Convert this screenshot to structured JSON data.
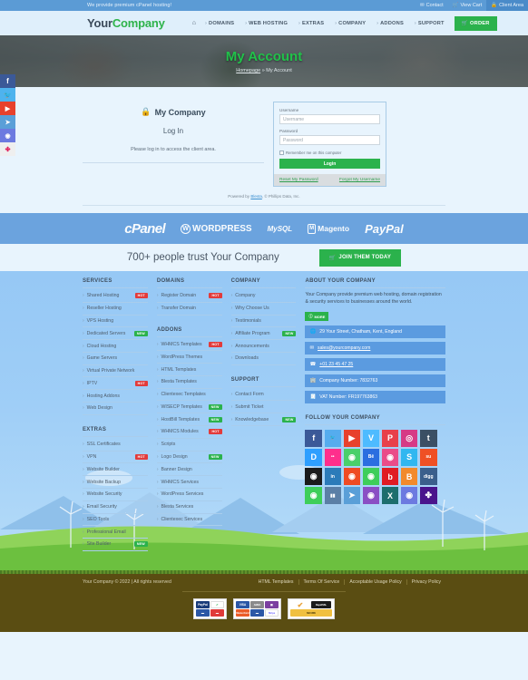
{
  "topbar": {
    "promo": "We provide premium cPanel hosting!",
    "links": [
      {
        "label": "Contact",
        "icon": "envelope-icon"
      },
      {
        "label": "View Cart",
        "icon": "cart-icon"
      },
      {
        "label": "Client Area",
        "icon": "lock-icon"
      }
    ]
  },
  "nav": {
    "logo_first": "Your",
    "logo_second": "Company",
    "items": [
      "DOMAINS",
      "WEB HOSTING",
      "EXTRAS",
      "COMPANY",
      "ADDONS",
      "SUPPORT"
    ],
    "order_label": "ORDER"
  },
  "hero": {
    "title": "My Account",
    "breadcrumb_home": "Homepage",
    "breadcrumb_sep": "»",
    "breadcrumb_current": "My Account"
  },
  "rail_social": [
    "facebook",
    "twitter",
    "youtube",
    "telegram",
    "discord",
    "slack"
  ],
  "login": {
    "company_title": "My Company",
    "heading": "Log In",
    "description": "Please log in to access the client area.",
    "username_label": "Username",
    "username_placeholder": "Username",
    "password_label": "Password",
    "password_placeholder": "Password",
    "remember_label": "Remember me on this computer",
    "submit_label": "Login",
    "reset_link": "Reset My Password",
    "forgot_link": "Forgot My Username",
    "powered_prefix": "Powered by",
    "powered_link": "Blesta",
    "powered_suffix": ", © Phillips Data, Inc."
  },
  "brands": [
    "cPanel",
    "WORDPRESS",
    "MySQL",
    "Magento",
    "PayPal"
  ],
  "trust": {
    "text": "700+ people trust Your Company",
    "button": "JOIN THEM TODAY"
  },
  "footer": {
    "services_title": "SERVICES",
    "services": [
      {
        "label": "Shared Hosting",
        "badge": "HOT"
      },
      {
        "label": "Reseller Hosting",
        "badge": ""
      },
      {
        "label": "VPS Hosting",
        "badge": ""
      },
      {
        "label": "Dedicated Servers",
        "badge": "NEW"
      },
      {
        "label": "Cloud Hosting",
        "badge": ""
      },
      {
        "label": "Game Servers",
        "badge": ""
      },
      {
        "label": "Virtual Private Network",
        "badge": ""
      },
      {
        "label": "IPTV",
        "badge": "HOT"
      },
      {
        "label": "Hosting Addons",
        "badge": ""
      },
      {
        "label": "Web Design",
        "badge": ""
      }
    ],
    "extras_title": "EXTRAS",
    "extras": [
      {
        "label": "SSL Certificates",
        "badge": ""
      },
      {
        "label": "VPN",
        "badge": "HOT"
      },
      {
        "label": "Website Builder",
        "badge": ""
      },
      {
        "label": "Website Backup",
        "badge": ""
      },
      {
        "label": "Website Security",
        "badge": ""
      },
      {
        "label": "Email Security",
        "badge": ""
      },
      {
        "label": "SEO Tools",
        "badge": ""
      },
      {
        "label": "Professional Email",
        "badge": ""
      },
      {
        "label": "Site Builder",
        "badge": "NEW"
      }
    ],
    "domains_title": "DOMAINS",
    "domains": [
      {
        "label": "Register Domain",
        "badge": "HOT"
      },
      {
        "label": "Transfer Domain",
        "badge": ""
      }
    ],
    "addons_title": "ADDONS",
    "addons": [
      {
        "label": "WHMCS Templates",
        "badge": "HOT"
      },
      {
        "label": "WordPress Themes",
        "badge": ""
      },
      {
        "label": "HTML Templates",
        "badge": ""
      },
      {
        "label": "Blesta Templates",
        "badge": ""
      },
      {
        "label": "Clientexec Templates",
        "badge": ""
      },
      {
        "label": "WISECP Templates",
        "badge": "NEW"
      },
      {
        "label": "HostBill Templates",
        "badge": "NEW"
      },
      {
        "label": "WHMCS Modules",
        "badge": "HOT"
      },
      {
        "label": "Scripts",
        "badge": ""
      },
      {
        "label": "Logo Design",
        "badge": "NEW"
      },
      {
        "label": "Banner Design",
        "badge": ""
      },
      {
        "label": "WHMCS Services",
        "badge": ""
      },
      {
        "label": "WordPress Services",
        "badge": ""
      },
      {
        "label": "Blesta Services",
        "badge": ""
      },
      {
        "label": "Clientexec Services",
        "badge": ""
      }
    ],
    "company_title": "COMPANY",
    "company": [
      {
        "label": "Company",
        "badge": ""
      },
      {
        "label": "Why Choose Us",
        "badge": ""
      },
      {
        "label": "Testimonials",
        "badge": ""
      },
      {
        "label": "Affiliate Program",
        "badge": "NEW"
      },
      {
        "label": "Announcements",
        "badge": ""
      },
      {
        "label": "Downloads",
        "badge": ""
      }
    ],
    "support_title": "SUPPORT",
    "support": [
      {
        "label": "Contact Form",
        "badge": ""
      },
      {
        "label": "Submit Ticket",
        "badge": ""
      },
      {
        "label": "Knowledgebase",
        "badge": "NEW"
      }
    ],
    "about_title": "ABOUT YOUR COMPANY",
    "about_text": "Your Company provide premium web hosting, domain registration & security services to businesses around the world.",
    "more_label": "MORE",
    "contacts": [
      {
        "icon": "globe-icon",
        "text": "29 Your Street, Chatham, Kent, England",
        "link": false
      },
      {
        "icon": "envelope-icon",
        "text": "sales@yourcompany.com",
        "link": true
      },
      {
        "icon": "phone-icon",
        "text": "+01 23 45 47 25",
        "link": true
      },
      {
        "icon": "building-icon",
        "text": "Company Number: 7832763",
        "link": false
      },
      {
        "icon": "receipt-icon",
        "text": "VAT Number: FR197763863",
        "link": false
      }
    ],
    "follow_title": "FOLLOW YOUR COMPANY",
    "social": [
      "facebook",
      "twitter",
      "youtube",
      "vimeo",
      "pinterest",
      "instagram",
      "tumblr",
      "disqus",
      "flickr",
      "wechat",
      "behance",
      "dribbble",
      "skype",
      "stumbleupon",
      "github",
      "linkedin",
      "reddit",
      "whatsapp",
      "bebo",
      "blogger",
      "digg",
      "line",
      "myspace",
      "telegram",
      "viber",
      "xing",
      "discord",
      "slack"
    ]
  },
  "bottom": {
    "copyright": "Your Company © 2022 | All rights reserved",
    "links": [
      "HTML Templates",
      "Terms Of Service",
      "Acceptable Usage Policy",
      "Privacy Policy"
    ],
    "payments": [
      "PayPal",
      "VISA",
      "MasterCard",
      "Stripe",
      "RapidSSL"
    ]
  },
  "colors": {
    "accent_green": "#2bb24c",
    "brand_blue": "#5b9bd5",
    "hot_badge": "#e23b3b",
    "new_badge": "#2bb24c"
  }
}
